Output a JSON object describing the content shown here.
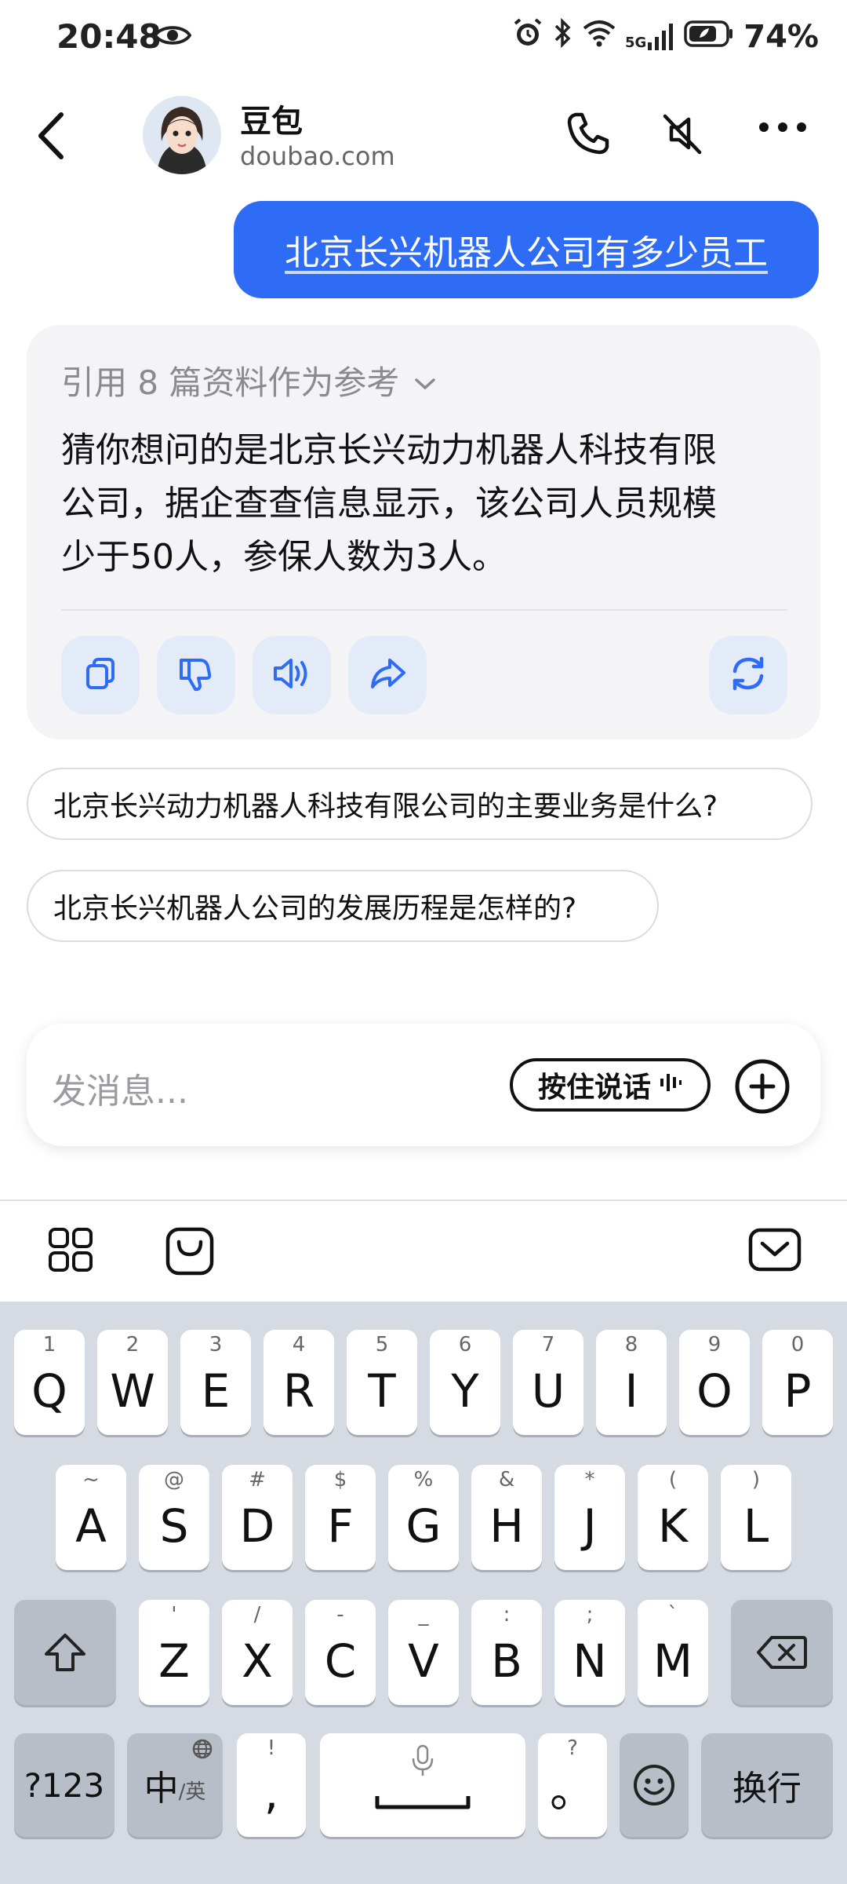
{
  "status_bar": {
    "time": "20:48",
    "network": "5G",
    "battery": "74%"
  },
  "header": {
    "contact_name": "豆包",
    "contact_subtitle": "doubao.com"
  },
  "chat": {
    "user_message": "北京长兴机器人公司有多少员工",
    "reference_label": "引用 8 篇资料作为参考",
    "answer_lines": [
      "猜你想问的是北京长兴动力机器人科技有限",
      "公司，据企查查信息显示，该公司人员规模",
      "少于50人，参保人数为3人。"
    ],
    "suggestions": [
      "北京长兴动力机器人科技有限公司的主要业务是什么?",
      "北京长兴机器人公司的发展历程是怎样的?"
    ]
  },
  "input": {
    "placeholder": "发消息...",
    "hold_to_talk": "按住说话"
  },
  "keyboard": {
    "row1": [
      {
        "hint": "1",
        "key": "Q"
      },
      {
        "hint": "2",
        "key": "W"
      },
      {
        "hint": "3",
        "key": "E"
      },
      {
        "hint": "4",
        "key": "R"
      },
      {
        "hint": "5",
        "key": "T"
      },
      {
        "hint": "6",
        "key": "Y"
      },
      {
        "hint": "7",
        "key": "U"
      },
      {
        "hint": "8",
        "key": "I"
      },
      {
        "hint": "9",
        "key": "O"
      },
      {
        "hint": "0",
        "key": "P"
      }
    ],
    "row2": [
      {
        "hint": "~",
        "key": "A"
      },
      {
        "hint": "@",
        "key": "S"
      },
      {
        "hint": "#",
        "key": "D"
      },
      {
        "hint": "$",
        "key": "F"
      },
      {
        "hint": "%",
        "key": "G"
      },
      {
        "hint": "&",
        "key": "H"
      },
      {
        "hint": "*",
        "key": "J"
      },
      {
        "hint": "(",
        "key": "K"
      },
      {
        "hint": ")",
        "key": "L"
      }
    ],
    "row3": [
      {
        "hint": "'",
        "key": "Z"
      },
      {
        "hint": "/",
        "key": "X"
      },
      {
        "hint": "-",
        "key": "C"
      },
      {
        "hint": "_",
        "key": "V"
      },
      {
        "hint": ":",
        "key": "B"
      },
      {
        "hint": ";",
        "key": "N"
      },
      {
        "hint": "`",
        "key": "M"
      }
    ],
    "symbols_key": "?123",
    "chinese_key": "中",
    "english_sub": "/英",
    "exclaim_hint": "!",
    "comma_key": ",",
    "question_hint": "?",
    "period_key": "。",
    "enter_key": "换行"
  },
  "colors": {
    "accent_blue": "#2f6cf6",
    "action_icon_blue": "#2f6cf6",
    "keyboard_bg": "#d6dbe3"
  },
  "icons": {
    "back": "chevron-left-icon",
    "call": "phone-icon",
    "mute": "speaker-off-icon",
    "more": "more-dots-icon",
    "copy": "copy-icon",
    "dislike": "thumbs-down-icon",
    "speak": "speaker-wave-icon",
    "share": "share-arrow-icon",
    "regenerate": "refresh-icon"
  }
}
